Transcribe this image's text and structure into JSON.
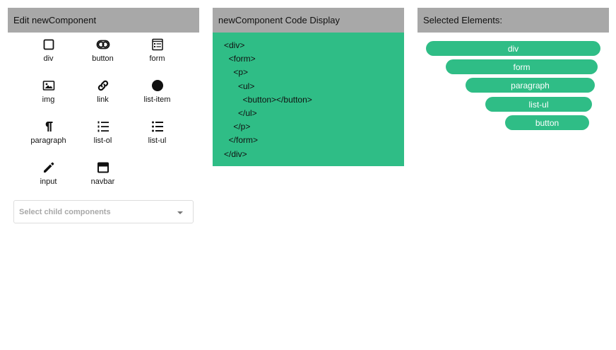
{
  "edit_panel": {
    "title": "Edit newComponent",
    "components": [
      {
        "label": "div",
        "icon": "square-outline-icon"
      },
      {
        "label": "button",
        "icon": "toggle-icon"
      },
      {
        "label": "form",
        "icon": "form-icon"
      },
      {
        "label": "img",
        "icon": "image-icon"
      },
      {
        "label": "link",
        "icon": "link-icon"
      },
      {
        "label": "list-item",
        "icon": "filled-circle-icon"
      },
      {
        "label": "paragraph",
        "icon": "pilcrow-icon"
      },
      {
        "label": "list-ol",
        "icon": "ordered-list-icon"
      },
      {
        "label": "list-ul",
        "icon": "bulleted-list-icon"
      },
      {
        "label": "input",
        "icon": "pencil-icon"
      },
      {
        "label": "navbar",
        "icon": "navbar-icon"
      }
    ],
    "select_placeholder": "Select child components"
  },
  "code_panel": {
    "title": "newComponent Code Display",
    "background": "#2fbd86",
    "lines": [
      "<div>",
      "  <form>",
      "    <p>",
      "      <ul>",
      "        <button></button>",
      "      </ul>",
      "    </p>",
      "  </form>",
      "</div>"
    ]
  },
  "selected_panel": {
    "title": "Selected Elements:",
    "chips": [
      "div",
      "form",
      "paragraph",
      "list-ul",
      "button"
    ],
    "chip_color": "#2fbd86"
  }
}
